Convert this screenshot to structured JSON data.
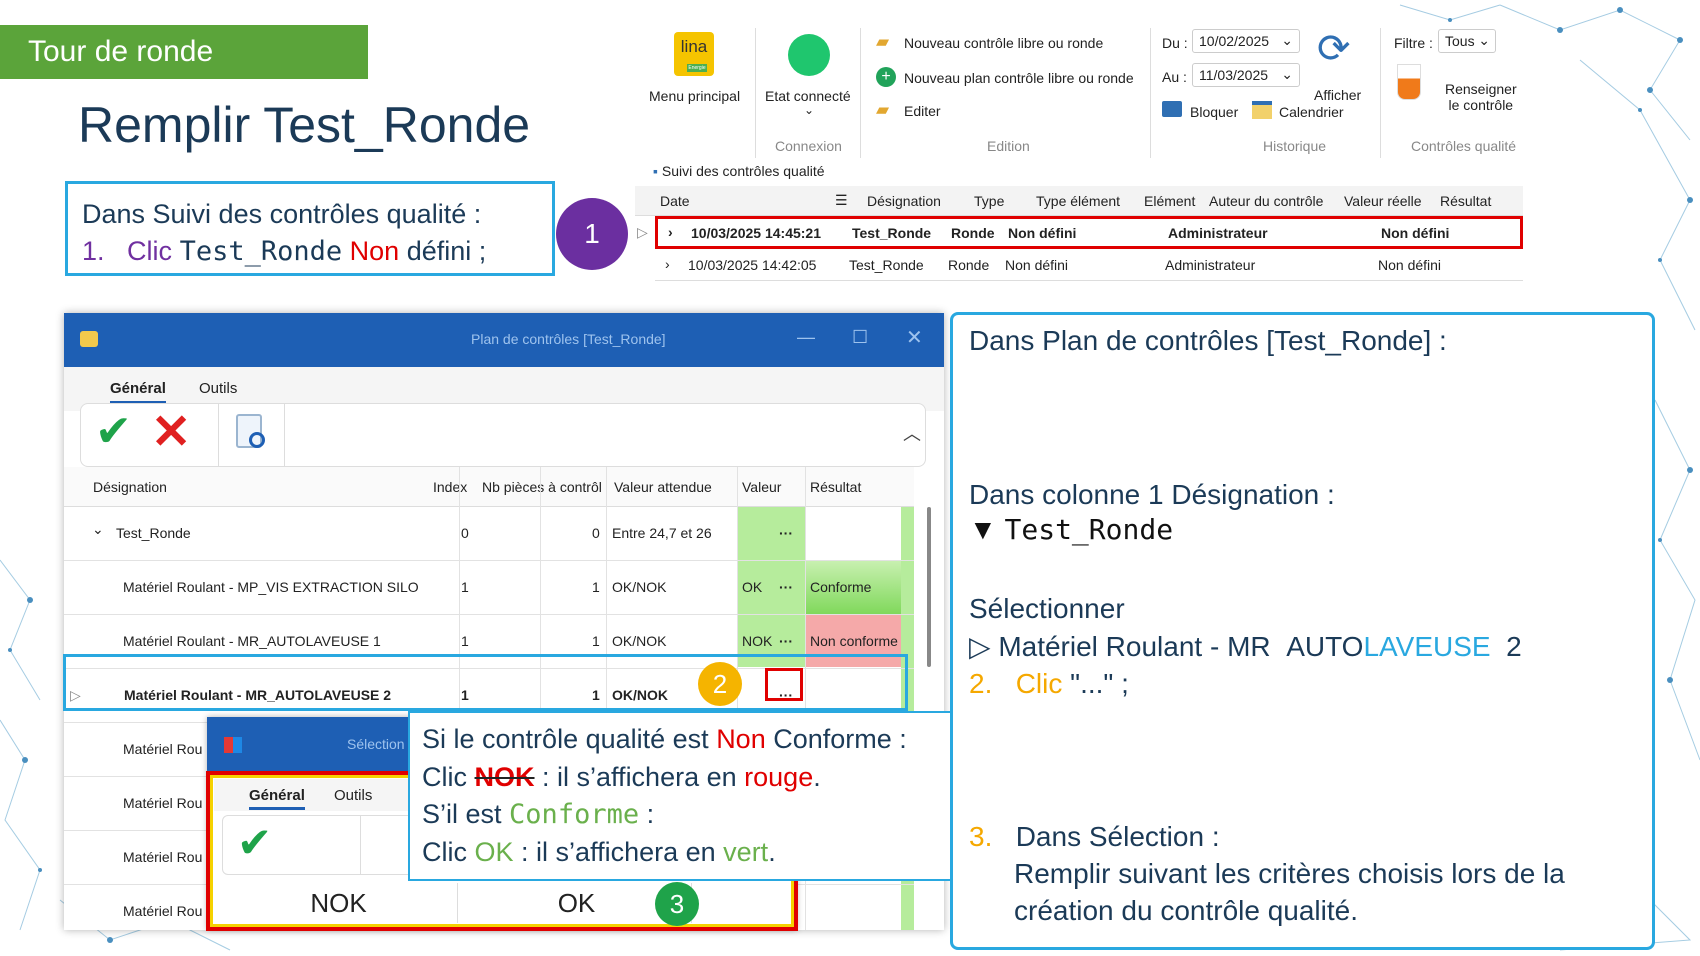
{
  "banner": "Tour de ronde",
  "title": "Remplir Test_Ronde",
  "instr1": {
    "line1": "Dans Suivi des contrôles qualité :",
    "num": "1.",
    "clic": "Clic",
    "mono": "Test_Ronde",
    "non": "Non",
    "rest": "défini ;"
  },
  "badges": {
    "b1": "1",
    "b2": "2",
    "b3": "3"
  },
  "ribbon": {
    "menu_principal": "Menu principal",
    "logo": "lina",
    "logo_sub": "Energie",
    "etat_connecte": "Etat connecté",
    "connexion": "Connexion",
    "nouveau_controle": "Nouveau contrôle libre ou ronde",
    "nouveau_plan": "Nouveau plan contrôle libre ou ronde",
    "editer": "Editer",
    "edition": "Edition",
    "du_label": "Du :",
    "du_value": "10/02/2025",
    "au_label": "Au :",
    "au_value": "11/03/2025",
    "bloquer": "Bloquer",
    "calendrier": "Calendrier",
    "afficher": "Afficher",
    "historique": "Historique",
    "filtre_label": "Filtre :",
    "filtre_value": "Tous",
    "renseigner1": "Renseigner",
    "renseigner2": "le contrôle",
    "controles_qualite": "Contrôles qualité"
  },
  "suivi_tab": "Suivi des contrôles qualité",
  "grid1": {
    "headers": [
      "Date",
      "Désignation",
      "Type",
      "Type élément",
      "Elément",
      "Auteur du contrôle",
      "Valeur réelle",
      "Résultat"
    ],
    "rows": [
      [
        "10/03/2025 14:45:21",
        "Test_Ronde",
        "Ronde",
        "Non défini",
        "",
        "Administrateur",
        "",
        "Non défini"
      ],
      [
        "10/03/2025 14:42:05",
        "Test_Ronde",
        "Ronde",
        "Non défini",
        "",
        "Administrateur",
        "",
        "Non défini"
      ]
    ]
  },
  "dialog": {
    "title": "Plan de contrôles [Test_Ronde]",
    "tab_general": "Général",
    "tab_outils": "Outils",
    "headers": [
      "Désignation",
      "Index",
      "Nb pièces à contrôl",
      "Valeur attendue",
      "Valeur",
      "Résultat"
    ],
    "rows": [
      {
        "designation": "Test_Ronde",
        "index": "0",
        "nb": "0",
        "attendue": "Entre 24,7 et 26",
        "valeur": "",
        "dots": "···",
        "resultat": ""
      },
      {
        "designation": "Matériel Roulant - MP_VIS EXTRACTION SILO",
        "index": "1",
        "nb": "1",
        "attendue": "OK/NOK",
        "valeur": "OK",
        "dots": "···",
        "resultat": "Conforme"
      },
      {
        "designation": "Matériel Roulant - MR_AUTOLAVEUSE 1",
        "index": "1",
        "nb": "1",
        "attendue": "OK/NOK",
        "valeur": "NOK",
        "dots": "···",
        "resultat": "Non conforme"
      },
      {
        "designation": "Matériel Roulant - MR_AUTOLAVEUSE 2",
        "index": "1",
        "nb": "1",
        "attendue": "OK/NOK",
        "valeur": "",
        "dots": "···",
        "resultat": ""
      },
      {
        "designation": "Matériel Rou"
      },
      {
        "designation": "Matériel Rou"
      },
      {
        "designation": "Matériel Rou"
      },
      {
        "designation": "Matériel Rou"
      }
    ]
  },
  "selection": {
    "title": "Sélection",
    "tab_general": "Général",
    "tab_outils": "Outils",
    "nok": "NOK",
    "ok": "OK"
  },
  "callout": {
    "l1a": "Si le contrôle qualité est",
    "l1b": "Non",
    "l1c": "Conforme :",
    "l2a": "Clic",
    "l2b": "NOK",
    "l2c": ": il s’affichera en",
    "l2d": "rouge",
    ".": ".",
    "l3a": "S’il est",
    "l3b": "Conforme",
    "l3c": ":",
    "l4a": "Clic",
    "l4b": "OK",
    "l4c": ": il s’affichera en",
    "l4d": "vert",
    "l4e": "."
  },
  "right": {
    "l1": "Dans Plan de contrôles [Test_Ronde] :",
    "l2": "Dans colonne 1 Désignation :",
    "l3a": "▼",
    "l3b": "Test_Ronde",
    "l4": "Sélectionner",
    "l5a": "▷ Matériel Roulant - MR",
    "l5b": "AUTO",
    "l5c": "LAVEUSE",
    "l5d": "2",
    "l6a": "2.",
    "l6b": "Clic",
    "l6c": "\"...\" ;",
    "l7a": "3.",
    "l7b": "Dans Sélection :",
    "l8": "Remplir suivant les critères choisis lors de la",
    "l9": "création du contrôle qualité."
  },
  "colors": {
    "accent_green": "#5ba43a",
    "title_blue": "#1b3a57",
    "frame_blue": "#29a8e0",
    "red": "#e00000",
    "purple": "#6b2fa0",
    "yellow": "#f5b400",
    "green_badge": "#1fa34a"
  }
}
